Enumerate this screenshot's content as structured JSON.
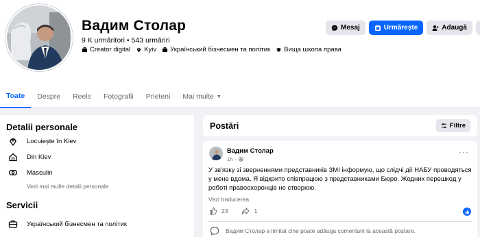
{
  "profile": {
    "name": "Вадим Столар",
    "followers": "9 K urmăritori • 543 urmăriri",
    "tags": [
      {
        "icon": "briefcase-icon",
        "label": "Creator digital"
      },
      {
        "icon": "location-pin-icon",
        "label": "Kyiv"
      },
      {
        "icon": "work-icon",
        "label": "Український бізнесмен та політик"
      },
      {
        "icon": "graduation-cap-icon",
        "label": "Вища школа права"
      }
    ]
  },
  "actions": {
    "message_label": "Mesaj",
    "follow_label": "Urmărește",
    "add_label": "Adaugă"
  },
  "tabs": [
    {
      "label": "Toate",
      "active": true
    },
    {
      "label": "Despre"
    },
    {
      "label": "Reels"
    },
    {
      "label": "Fotografii"
    },
    {
      "label": "Prieteni"
    },
    {
      "label": "Mai multe"
    }
  ],
  "personal": {
    "title": "Detalii personale",
    "items": [
      {
        "icon": "location-pin-icon",
        "label": "Locuiește în Kiev"
      },
      {
        "icon": "home-icon",
        "label": "Din Kiev"
      },
      {
        "icon": "gender-icon",
        "label": "Masculin"
      }
    ],
    "more_link": "Vezi mai multe detalii personale"
  },
  "services": {
    "title": "Servicii",
    "items": [
      {
        "icon": "briefcase-icon",
        "label": "Український бізнесмен та політик"
      }
    ]
  },
  "posts": {
    "title": "Postări",
    "filter_label": "Filtre"
  },
  "post": {
    "author": "Вадим Столар",
    "time": "1h",
    "text": "У зв'язку зі зверненнями представників ЗМІ інформую, що слідчі дії НАБУ проводяться у мене вдома. Я відкрито співпрацюю з представниками Бюро. Жодних перешкод у роботі правоохоронців не створюю.",
    "translate_link": "Vezi traducerea",
    "likes": "23",
    "shares": "1",
    "comment_notice": "Вадим Столар a limitat cine poate adăuga comentarii la această postare."
  },
  "colors": {
    "accent": "#0866ff",
    "background": "#f0f2f5",
    "secondary_text": "#65676b"
  }
}
